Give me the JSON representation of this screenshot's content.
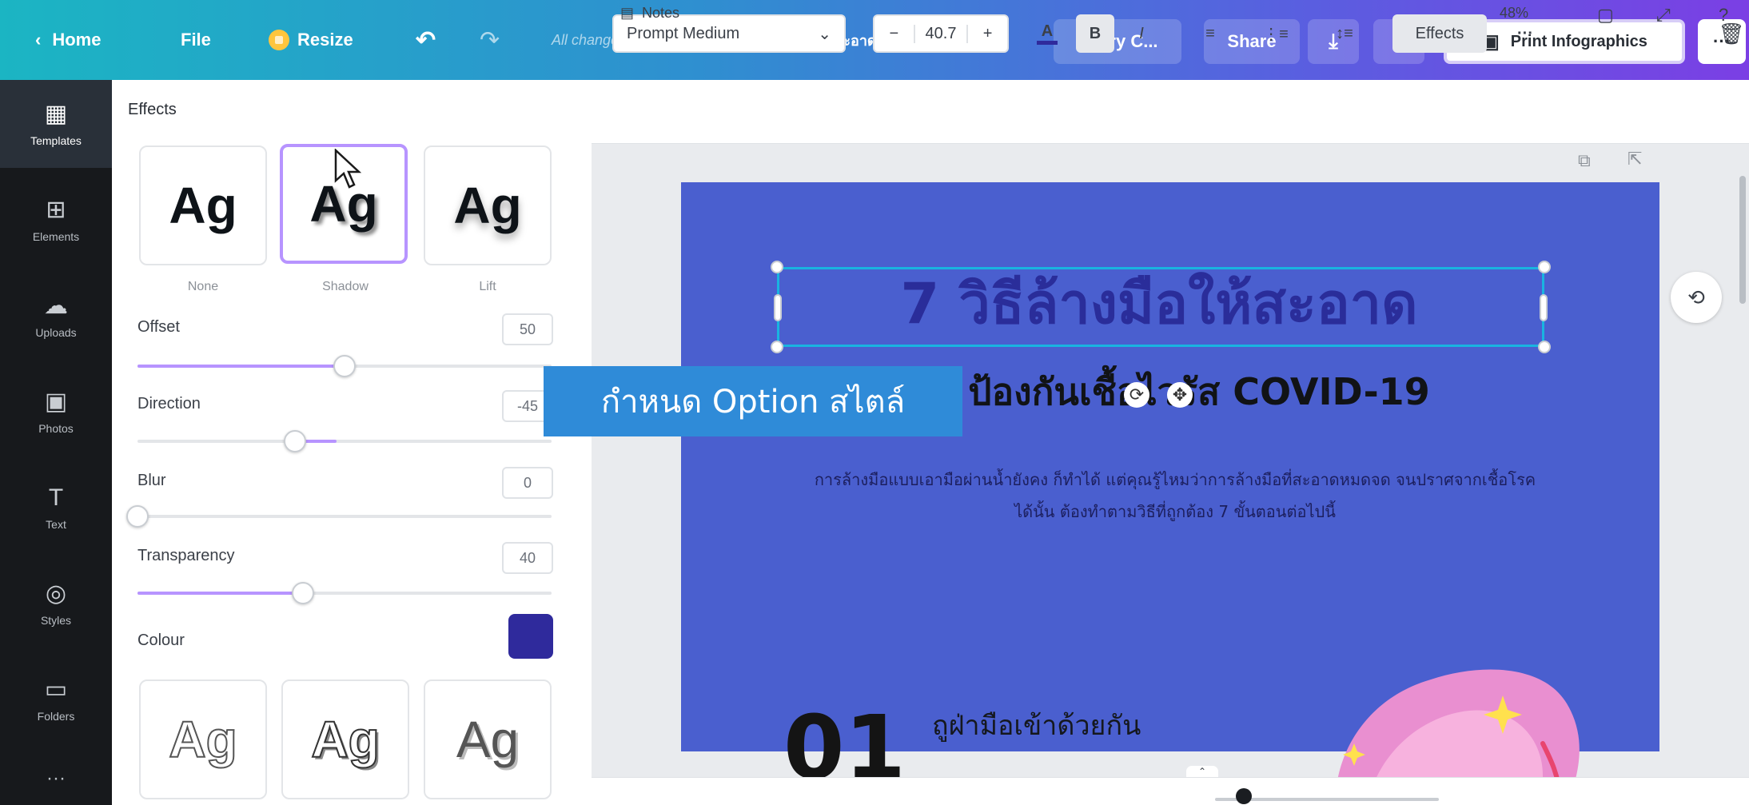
{
  "topbar": {
    "home": "Home",
    "file": "File",
    "resize": "Resize",
    "saved_status": "All changes saved",
    "doc_title": "7 วิธีล้างมือให้สะอาด ป้องกัน...",
    "try": "Try C...",
    "share": "Share",
    "print": "Print Infographics",
    "more": "···"
  },
  "rail": {
    "items": [
      {
        "label": "Templates",
        "icon": "templates-icon"
      },
      {
        "label": "Elements",
        "icon": "elements-icon"
      },
      {
        "label": "Uploads",
        "icon": "uploads-icon"
      },
      {
        "label": "Photos",
        "icon": "photos-icon"
      },
      {
        "label": "Text",
        "icon": "text-icon"
      },
      {
        "label": "Styles",
        "icon": "styles-icon"
      },
      {
        "label": "Folders",
        "icon": "folders-icon"
      },
      {
        "label": "···",
        "icon": "more-icon"
      }
    ]
  },
  "panel": {
    "title": "Effects",
    "styles_top": [
      {
        "sample": "Ag",
        "label": "None"
      },
      {
        "sample": "Ag",
        "label": "Shadow"
      },
      {
        "sample": "Ag",
        "label": "Lift"
      }
    ],
    "controls": [
      {
        "label": "Offset",
        "value": "50",
        "fraction": 0.5
      },
      {
        "label": "Direction",
        "value": "-45",
        "fraction": 0.38
      },
      {
        "label": "Blur",
        "value": "0",
        "fraction": 0.0
      },
      {
        "label": "Transparency",
        "value": "40",
        "fraction": 0.4
      }
    ],
    "colour_label": "Colour",
    "colour_value": "#2f2a9c",
    "styles_bottom": [
      {
        "sample": "Ag"
      },
      {
        "sample": "Ag"
      },
      {
        "sample": "Ag"
      }
    ]
  },
  "textbar": {
    "font": "Prompt Medium",
    "size": "40.7",
    "minus": "−",
    "plus": "+",
    "bold": "B",
    "italic": "I",
    "effects": "Effects",
    "more": "···"
  },
  "canvas": {
    "title": "7 วิธีล้างมือให้สะอาด",
    "subtitle": "ป้องกันเชื้อไวรัส COVID-19",
    "desc": "การล้างมือแบบเอามือผ่านน้ำยังคง ก็ทำได้ แต่คุณรู้ไหมว่าการล้างมือที่สะอาดหมดจด จนปราศจากเชื้อโรคได้นั้น ต้องทำตามวิธีที่ถูกต้อง 7 ขั้นตอนต่อไปนี้",
    "step_num": "01",
    "step_title": "ถูฝ่ามือเข้าด้วยกัน",
    "callout": "กำหนด Option สไตล์",
    "page_color": "#4a5fcf"
  },
  "bottombar": {
    "notes": "Notes",
    "zoom": "48%"
  }
}
